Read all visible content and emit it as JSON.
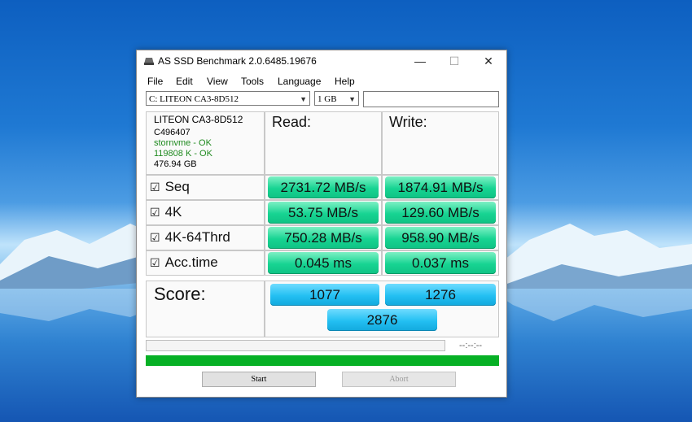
{
  "window": {
    "title": "AS SSD Benchmark 2.0.6485.19676",
    "minimize": "—",
    "maximize": "☐",
    "close": "✕"
  },
  "menu": [
    "File",
    "Edit",
    "View",
    "Tools",
    "Language",
    "Help"
  ],
  "toolbar": {
    "drive": "C: LITEON CA3-8D512",
    "size": "1 GB",
    "text": ""
  },
  "drive_info": {
    "model": "LITEON CA3-8D512",
    "firmware": "C496407",
    "driver": "stornvme - OK",
    "alignment": "119808 K - OK",
    "capacity": "476.94 GB"
  },
  "headers": {
    "read": "Read:",
    "write": "Write:"
  },
  "rows": [
    {
      "label": "Seq",
      "checked": "☑",
      "read": "2731.72 MB/s",
      "write": "1874.91 MB/s"
    },
    {
      "label": "4K",
      "checked": "☑",
      "read": "53.75 MB/s",
      "write": "129.60 MB/s"
    },
    {
      "label": "4K-64Thrd",
      "checked": "☑",
      "read": "750.28 MB/s",
      "write": "958.90 MB/s"
    },
    {
      "label": "Acc.time",
      "checked": "☑",
      "read": "0.045 ms",
      "write": "0.037 ms"
    }
  ],
  "score": {
    "label": "Score:",
    "read": "1077",
    "write": "1276",
    "total": "2876"
  },
  "status": {
    "time": "--:--:--",
    "progress": 1.0
  },
  "buttons": {
    "start": "Start",
    "abort": "Abort"
  },
  "colors": {
    "progress": "#06b025",
    "result_pill": "#17d492",
    "score_pill": "#23bff2"
  }
}
